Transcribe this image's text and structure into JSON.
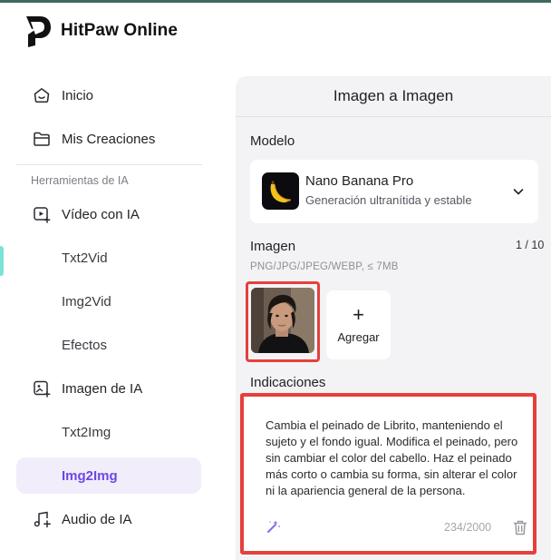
{
  "app": {
    "brand": "HitPaw Online",
    "accent_color": "#6b48e6",
    "highlight_color": "#e5403b"
  },
  "sidebar": {
    "items": [
      {
        "label": "Inicio",
        "icon": "home-icon"
      },
      {
        "label": "Mis Creaciones",
        "icon": "folder-icon"
      }
    ],
    "section_label": "Herramientas de IA",
    "tools": [
      {
        "label": "Vídeo con IA",
        "icon": "video-ai-icon"
      },
      {
        "label": "Txt2Vid"
      },
      {
        "label": "Img2Vid"
      },
      {
        "label": "Efectos"
      },
      {
        "label": "Imagen de IA",
        "icon": "image-ai-icon"
      },
      {
        "label": "Txt2Img"
      },
      {
        "label": "Img2Img",
        "active": true
      },
      {
        "label": "Audio de IA",
        "icon": "music-icon"
      }
    ]
  },
  "panel": {
    "title": "Imagen a Imagen",
    "model": {
      "label": "Modelo",
      "name": "Nano Banana Pro",
      "description": "Generación ultranítida y estable",
      "thumbnail_icon": "banana-icon"
    },
    "image": {
      "label": "Imagen",
      "count": "1 / 10",
      "formats": "PNG/JPG/JPEG/WEBP, ≤ 7MB",
      "add_label": "Agregar",
      "add_symbol": "+"
    },
    "prompt": {
      "label": "Indicaciones",
      "text": "Cambia el peinado de Librito, manteniendo el sujeto y el fondo igual. Modifica el peinado, pero sin cambiar el color del cabello. Haz el peinado más corto o cambia su forma, sin alterar el color ni la apariencia general de la persona.",
      "char_count": "234/2000"
    }
  }
}
